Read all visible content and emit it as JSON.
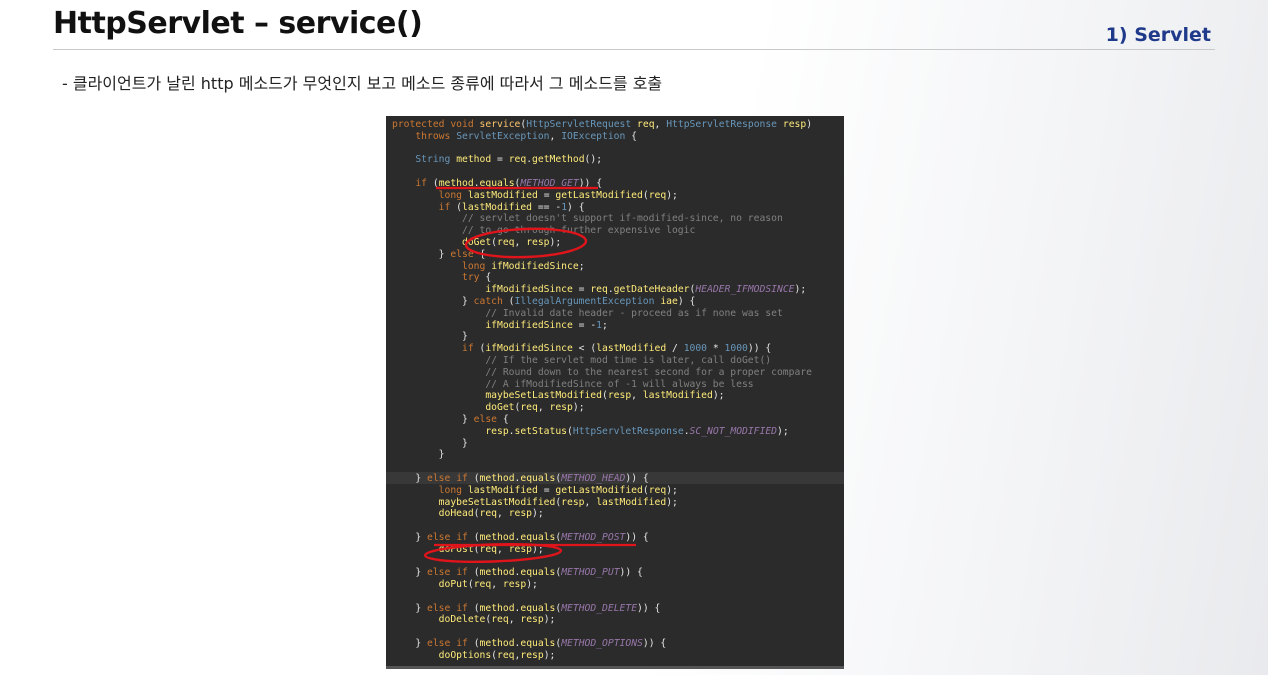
{
  "header": {
    "title": "HttpServlet – service()",
    "section": "1) Servlet"
  },
  "bullet": "- 클라이언트가 날린 http 메소드가 무엇인지 보고 메소드 종류에 따라서 그 메소드를 호출",
  "code": {
    "lines": [
      "protected void service(HttpServletRequest req, HttpServletResponse resp)",
      "    throws ServletException, IOException {",
      "",
      "    String method = req.getMethod();",
      "",
      "    if (method.equals(METHOD_GET)) {",
      "        long lastModified = getLastModified(req);",
      "        if (lastModified == -1) {",
      "            // servlet doesn't support if-modified-since, no reason",
      "            // to go through further expensive logic",
      "            doGet(req, resp);",
      "        } else {",
      "            long ifModifiedSince;",
      "            try {",
      "                ifModifiedSince = req.getDateHeader(HEADER_IFMODSINCE);",
      "            } catch (IllegalArgumentException iae) {",
      "                // Invalid date header - proceed as if none was set",
      "                ifModifiedSince = -1;",
      "            }",
      "            if (ifModifiedSince < (lastModified / 1000 * 1000)) {",
      "                // If the servlet mod time is later, call doGet()",
      "                // Round down to the nearest second for a proper compare",
      "                // A ifModifiedSince of -1 will always be less",
      "                maybeSetLastModified(resp, lastModified);",
      "                doGet(req, resp);",
      "            } else {",
      "                resp.setStatus(HttpServletResponse.SC_NOT_MODIFIED);",
      "            }",
      "        }",
      "",
      "    } else if (method.equals(METHOD_HEAD)) {",
      "        long lastModified = getLastModified(req);",
      "        maybeSetLastModified(resp, lastModified);",
      "        doHead(req, resp);",
      "",
      "    } else if (method.equals(METHOD_POST)) {",
      "        doPost(req, resp);",
      "",
      "    } else if (method.equals(METHOD_PUT)) {",
      "        doPut(req, resp);",
      "",
      "    } else if (method.equals(METHOD_DELETE)) {",
      "        doDelete(req, resp);",
      "",
      "    } else if (method.equals(METHOD_OPTIONS)) {",
      "        doOptions(req,resp);"
    ]
  },
  "colors": {
    "annotation": "#e0141b",
    "section_label": "#1f3a8a",
    "code_background": "#2b2b2b"
  }
}
